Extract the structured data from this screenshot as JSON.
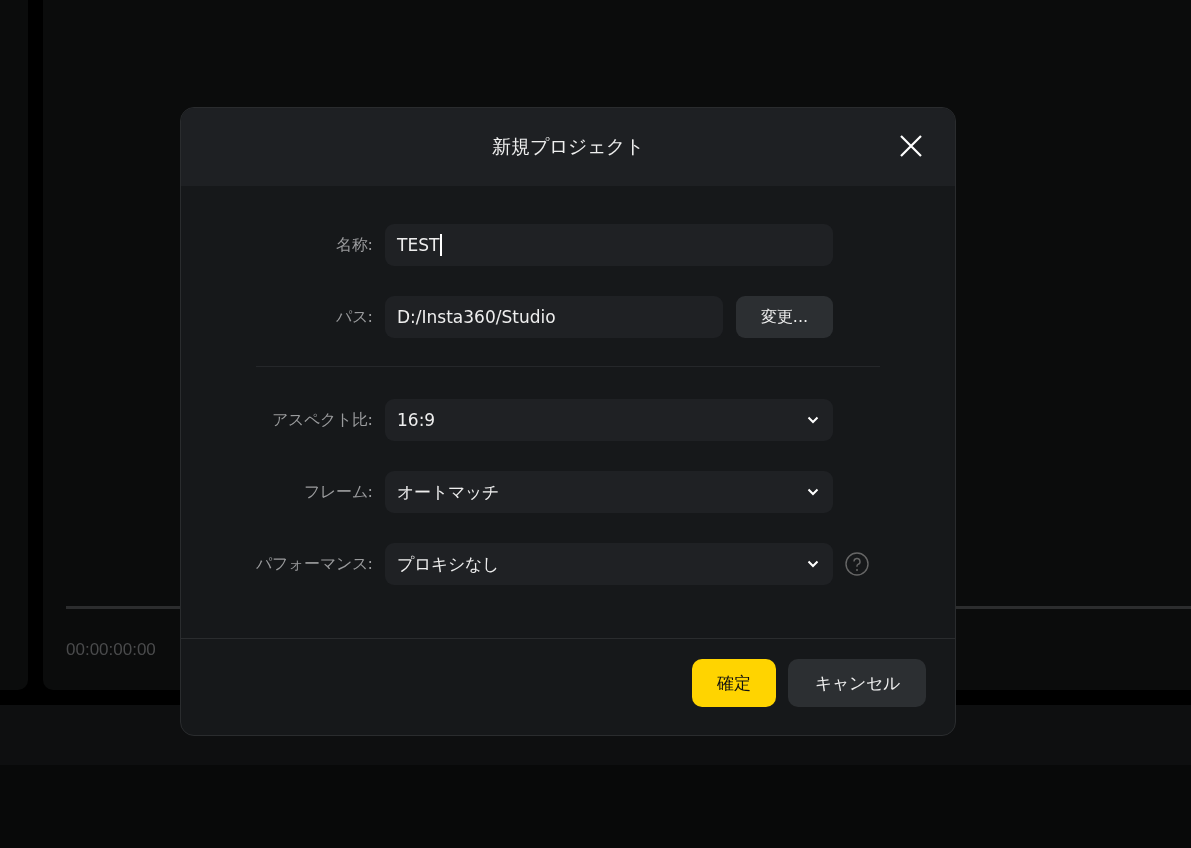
{
  "background": {
    "timecode": "00:00:00:00"
  },
  "dialog": {
    "title": "新規プロジェクト",
    "fields": [
      {
        "kind": "text",
        "label": "名称:",
        "value": "TEST",
        "focused": true
      },
      {
        "kind": "path",
        "label": "パス:",
        "value": "D:/Insta360/Studio",
        "button": "変更..."
      },
      {
        "kind": "select",
        "label": "アスペクト比:",
        "value": "16:9",
        "help": false
      },
      {
        "kind": "select",
        "label": "フレーム:",
        "value": "オートマッチ",
        "help": false
      },
      {
        "kind": "select",
        "label": "パフォーマンス:",
        "value": "プロキシなし",
        "help": true
      }
    ],
    "buttons": [
      {
        "kind": "primary",
        "label": "確定"
      },
      {
        "kind": "secondary",
        "label": "キャンセル"
      }
    ]
  }
}
